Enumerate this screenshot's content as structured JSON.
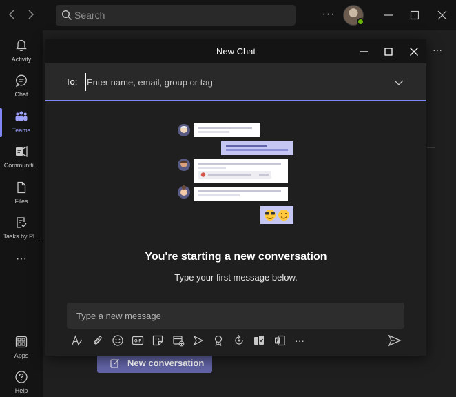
{
  "topbar": {
    "back_icon": "chevron-left-icon",
    "forward_icon": "chevron-right-icon",
    "search_placeholder": "Search",
    "more_label": "···",
    "presence_color": "#6bb700"
  },
  "rail": {
    "items": [
      {
        "label": "Activity",
        "icon": "bell-icon"
      },
      {
        "label": "Chat",
        "icon": "chat-icon"
      },
      {
        "label": "Teams",
        "icon": "teams-icon"
      },
      {
        "label": "Communiti...",
        "icon": "communities-icon"
      },
      {
        "label": "Files",
        "icon": "file-icon"
      },
      {
        "label": "Tasks by Pl...",
        "icon": "tasks-icon"
      }
    ],
    "more_label": "···",
    "apps_label": "Apps",
    "help_label": "Help",
    "active_color": "#7f85f5"
  },
  "modal": {
    "title": "New Chat",
    "to_label": "To:",
    "to_placeholder": "Enter name, email, group or tag",
    "heading": "You're starting a new conversation",
    "subtext": "Type your first message below.",
    "compose_placeholder": "Type a new message",
    "gif_label": "GIF",
    "more_label": "···"
  },
  "background": {
    "new_conversation_label": "New conversation",
    "more_label": "···",
    "accent": "#6264a7"
  }
}
